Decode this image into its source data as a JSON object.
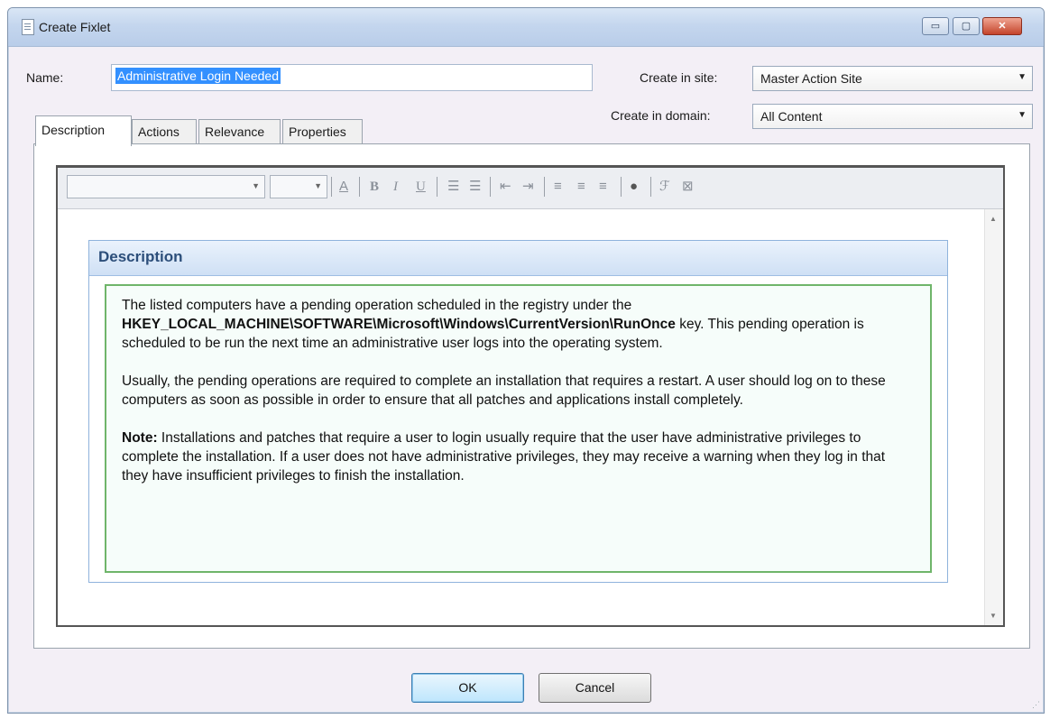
{
  "window": {
    "title": "Create Fixlet",
    "controls": {
      "minimize": "▭",
      "maximize": "▢",
      "close": "✕"
    }
  },
  "form": {
    "name_label": "Name:",
    "name_value": "Administrative Login Needed",
    "site_label": "Create in site:",
    "site_value": "Master Action Site",
    "domain_label": "Create in domain:",
    "domain_value": "All Content"
  },
  "tabs": [
    {
      "label": "Description",
      "active": true
    },
    {
      "label": "Actions",
      "active": false
    },
    {
      "label": "Relevance",
      "active": false
    },
    {
      "label": "Properties",
      "active": false
    }
  ],
  "toolbar": {
    "font_family_value": "",
    "font_size_value": "",
    "icons": [
      "font-color-icon",
      "bold-icon",
      "italic-icon",
      "underline-icon",
      "numbered-list-icon",
      "bulleted-list-icon",
      "outdent-icon",
      "indent-icon",
      "align-left-icon",
      "align-center-icon",
      "align-right-icon",
      "insert-link-icon",
      "clear-formatting-icon",
      "insert-table-icon"
    ],
    "glyphs": {
      "font_color": "A",
      "bold": "B",
      "italic": "I",
      "underline": "U",
      "numbered_list": "☰",
      "bulleted_list": "☰",
      "outdent": "⇤",
      "indent": "⇥",
      "align_left": "≡",
      "align_center": "≡",
      "align_right": "≡",
      "link": "●",
      "clear": "ℱ",
      "table": "⊠"
    }
  },
  "description": {
    "header": "Description",
    "p1_a": "The listed computers have a pending operation scheduled in the registry under the ",
    "p1_b": "HKEY_LOCAL_MACHINE\\SOFTWARE\\Microsoft\\Windows\\CurrentVersion\\RunOnce",
    "p1_c": " key. This pending operation is scheduled to be run the next time an administrative user logs into the operating system.",
    "p2": "Usually, the pending operations are required to complete an installation that requires a restart. A user should log on to these computers as soon as possible in order to ensure that all patches and applications install completely.",
    "p3_label": "Note:",
    "p3_text": " Installations and patches that require a user to login usually require that the user have administrative privileges to complete the installation. If a user does not have administrative privileges, they may receive a warning when they log in that they have insufficient privileges to finish the installation."
  },
  "buttons": {
    "ok": "OK",
    "cancel": "Cancel"
  },
  "colors": {
    "title_bar": "#c4d6ee",
    "window_bg": "#f3eff6",
    "description_header": "#2c4e7a",
    "description_border": "#6fb56a",
    "selection": "#3390ff"
  }
}
